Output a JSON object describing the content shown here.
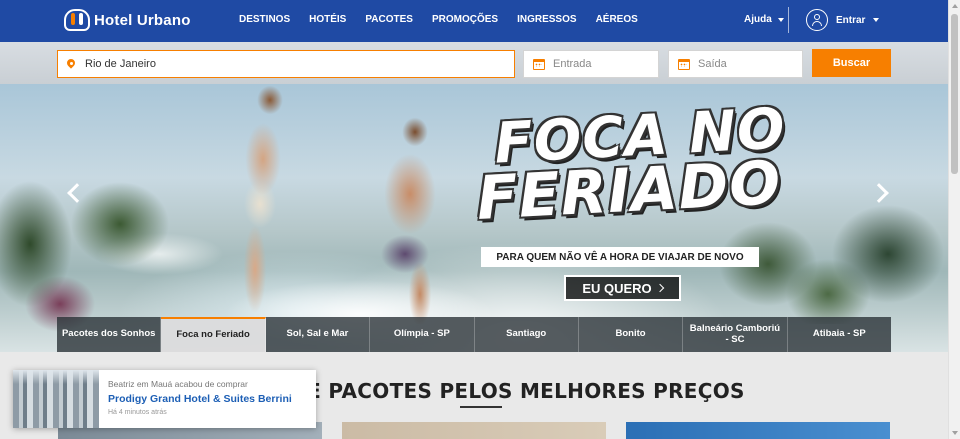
{
  "colors": {
    "nav_bg": "#1f4aa4",
    "accent": "#f77f00",
    "link": "#1d5fb5"
  },
  "brand": {
    "name": "Hotel Urbano"
  },
  "nav": {
    "items": [
      {
        "label": "DESTINOS"
      },
      {
        "label": "HOTÉIS"
      },
      {
        "label": "PACOTES"
      },
      {
        "label": "PROMOÇÕES"
      },
      {
        "label": "INGRESSOS"
      },
      {
        "label": "AÉREOS"
      }
    ],
    "help_label": "Ajuda",
    "login_label": "Entrar"
  },
  "search": {
    "destination_value": "Rio de Janeiro",
    "checkin_placeholder": "Entrada",
    "checkout_placeholder": "Saída",
    "button_label": "Buscar"
  },
  "hero": {
    "headline_line1": "FOCA NO",
    "headline_line2": "FERIADO",
    "tagline": "PARA QUEM NÃO VÊ A HORA DE VIAJAR DE NOVO",
    "cta_label": "EU QUERO"
  },
  "slide_tabs": [
    {
      "label": "Pacotes dos Sonhos"
    },
    {
      "label": "Foca no Feriado"
    },
    {
      "label": "Sol, Sal e Mar"
    },
    {
      "label": "Olímpia - SP"
    },
    {
      "label": "Santiago"
    },
    {
      "label": "Bonito"
    },
    {
      "label": "Balneário Camboriú - SC"
    },
    {
      "label": "Atibaia - SP"
    }
  ],
  "section": {
    "title": "HOTÉIS E PACOTES PELOS MELHORES PREÇOS"
  },
  "toast": {
    "line1": "Beatriz em Mauá acabou de comprar",
    "hotel": "Prodigy Grand Hotel & Suites Berrini",
    "time": "Há 4 minutos atrás"
  }
}
